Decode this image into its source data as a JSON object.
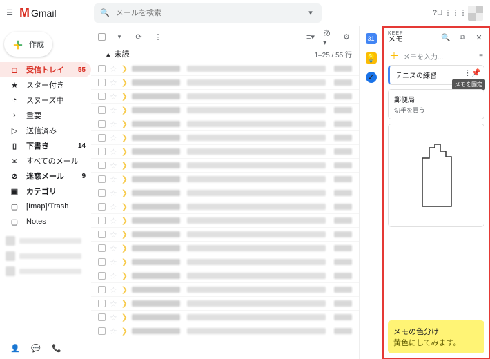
{
  "header": {
    "logo_text": "Gmail",
    "search_placeholder": "メールを検索"
  },
  "compose_label": "作成",
  "nav": [
    {
      "icon": "◻",
      "label": "受信トレイ",
      "count": "55",
      "active": true,
      "bold": true
    },
    {
      "icon": "★",
      "label": "スター付き"
    },
    {
      "icon": "◔",
      "label": "スヌーズ中"
    },
    {
      "icon": "›",
      "label": "重要"
    },
    {
      "icon": "▷",
      "label": "送信済み"
    },
    {
      "icon": "▯",
      "label": "下書き",
      "count": "14",
      "bold": true
    },
    {
      "icon": "✉",
      "label": "すべてのメール"
    },
    {
      "icon": "⊘",
      "label": "迷惑メール",
      "count": "9",
      "bold": true
    },
    {
      "icon": "▣",
      "label": "カテゴリ",
      "bold": true
    },
    {
      "icon": "▢",
      "label": "[Imap]/Trash"
    },
    {
      "icon": "▢",
      "label": "Notes"
    }
  ],
  "section": {
    "caret": "▴",
    "label": "未読",
    "page": "1–25 / 55 行"
  },
  "rows": 20,
  "keep": {
    "brand": "KEEP",
    "title": "メモ",
    "input_placeholder": "メモを入力...",
    "tooltip": "メモを固定",
    "notes": [
      {
        "title": "テニスの練習"
      },
      {
        "title": "郵便局",
        "body": "切手を買う"
      }
    ],
    "yellow": {
      "title": "メモの色分け",
      "body": "黄色にしてみます。"
    }
  }
}
